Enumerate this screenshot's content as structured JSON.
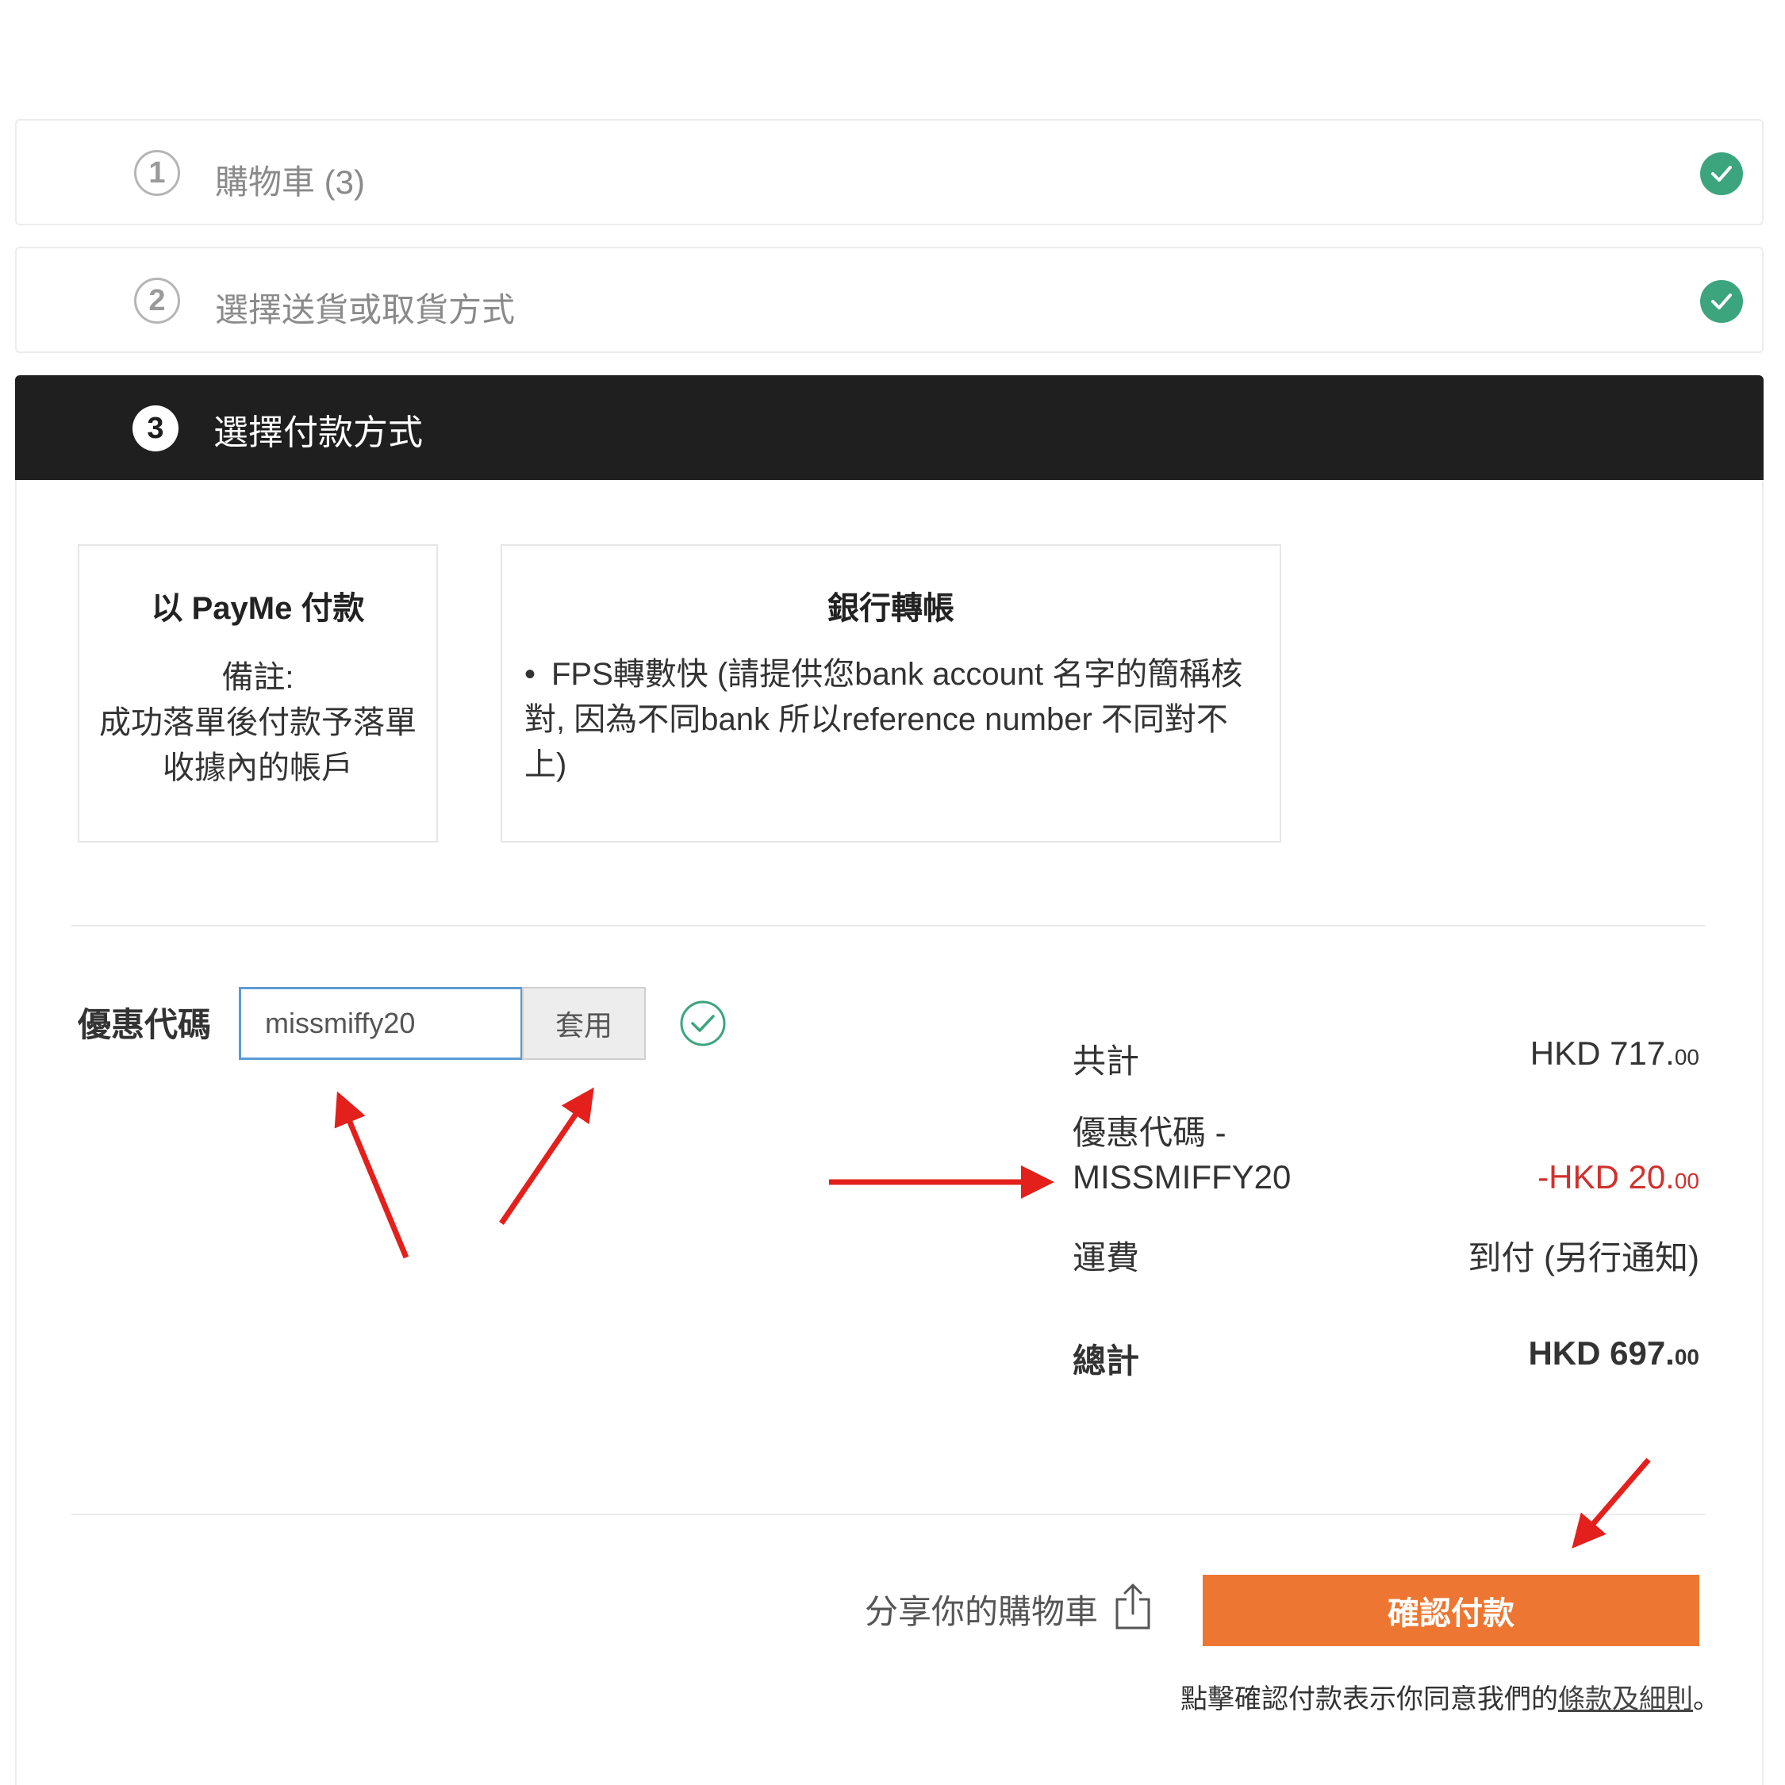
{
  "steps": [
    {
      "number": "1",
      "label": "購物車 (3)"
    },
    {
      "number": "2",
      "label": "選擇送貨或取貨方式"
    },
    {
      "number": "3",
      "label": "選擇付款方式"
    }
  ],
  "payment_options": {
    "payme": {
      "title": "以 PayMe 付款",
      "note_lines": [
        "備註:",
        "成功落單後付款予落單",
        "收據內的帳戶"
      ]
    },
    "bank": {
      "title": "銀行轉帳",
      "bullet": "FPS轉數快 (請提供您bank account 名字的簡稱核對, 因為不同bank 所以reference number 不同對不上)"
    }
  },
  "coupon": {
    "label": "優惠代碼",
    "value": "missmiffy20",
    "apply_label": "套用"
  },
  "summary": {
    "subtotal_label": "共計",
    "subtotal_value": "HKD 717.",
    "subtotal_cents": "00",
    "discount_label_line1": "優惠代碼 -",
    "discount_label_line2": "MISSMIFFY20",
    "discount_value": "-HKD 20.",
    "discount_cents": "00",
    "shipping_label": "運費",
    "shipping_value": "到付 (另行通知)",
    "total_label": "總計",
    "total_value": "HKD 697.",
    "total_cents": "00"
  },
  "footer": {
    "share_label": "分享你的購物車",
    "confirm_label": "確認付款",
    "terms_prefix": "點擊確認付款表示你同意我們的",
    "terms_link": "條款及細則",
    "terms_suffix": "。"
  },
  "colors": {
    "check_green": "#3ca57e",
    "confirm_orange": "#ed7732",
    "discount_red": "#d0312d",
    "annotation_red": "#e3201b"
  }
}
